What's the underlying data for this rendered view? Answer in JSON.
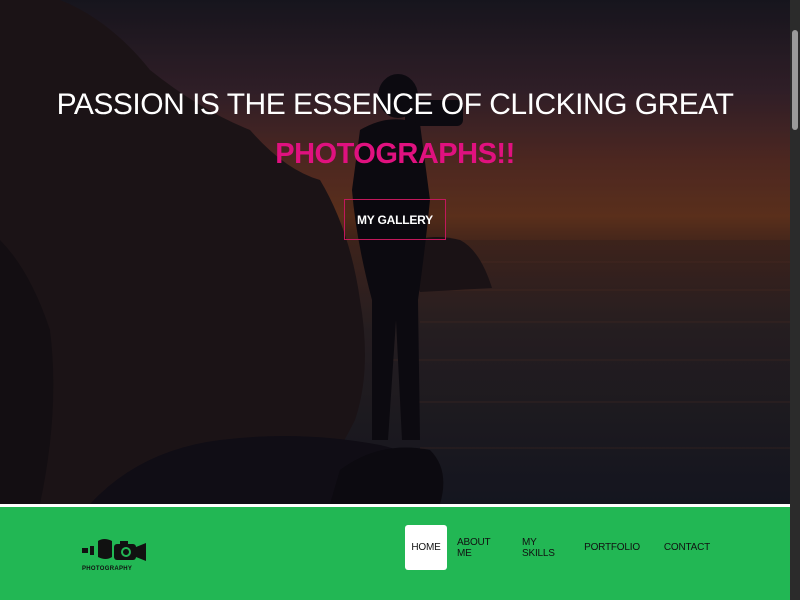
{
  "hero": {
    "headline": "PASSION IS THE ESSENCE OF CLICKING GREAT",
    "highlight": "PHOTOGRAPHS!!",
    "cta_label": "MY GALLERY"
  },
  "logo": {
    "icon": "camera-logo",
    "text": "PHOTOGRAPHY"
  },
  "nav": {
    "items": [
      {
        "label": "HOME",
        "active": true
      },
      {
        "label": "ABOUT ME"
      },
      {
        "label": "MY SKILLS"
      },
      {
        "label": "PORTFOLIO"
      },
      {
        "label": "CONTACT"
      }
    ]
  },
  "colors": {
    "accent": "#e0117f",
    "navbar": "#22b754",
    "button_border": "#c2185b"
  }
}
